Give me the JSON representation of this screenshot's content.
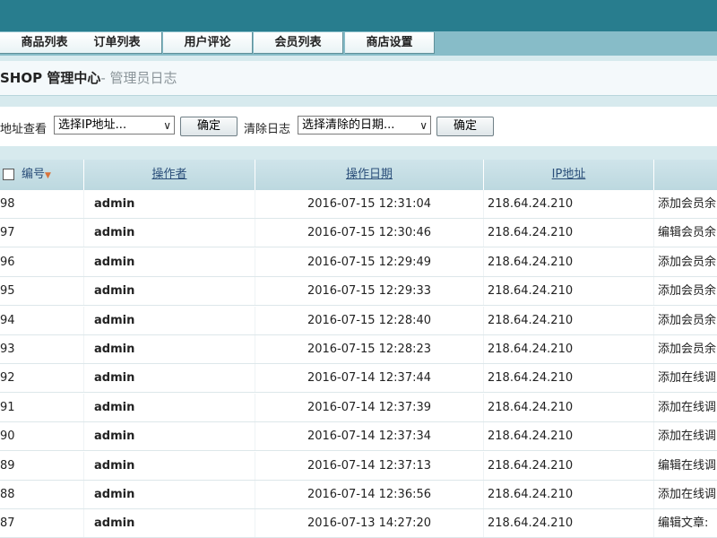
{
  "nav": {
    "tabs": [
      {
        "label": "商品列表"
      },
      {
        "label": "订单列表"
      },
      {
        "label": "用户评论"
      },
      {
        "label": "会员列表"
      },
      {
        "label": "商店设置"
      }
    ]
  },
  "title": {
    "main": "SHOP 管理中心",
    "sub": "- 管理员日志"
  },
  "filters": {
    "ip_label": "地址查看",
    "ip_select_value": "选择IP地址...",
    "confirm_label": "确定",
    "clear_label": "清除日志",
    "clear_select_value": "选择清除的日期...",
    "confirm2_label": "确定"
  },
  "table": {
    "headers": {
      "id": "编号",
      "sort_indicator": "▼",
      "user": "操作者",
      "date": "操作日期",
      "ip": "IP地址"
    },
    "rows": [
      {
        "id": "98",
        "user": "admin",
        "date": "2016-07-15 12:31:04",
        "ip": "218.64.24.210",
        "action": "添加会员余"
      },
      {
        "id": "97",
        "user": "admin",
        "date": "2016-07-15 12:30:46",
        "ip": "218.64.24.210",
        "action": "编辑会员余"
      },
      {
        "id": "96",
        "user": "admin",
        "date": "2016-07-15 12:29:49",
        "ip": "218.64.24.210",
        "action": "添加会员余"
      },
      {
        "id": "95",
        "user": "admin",
        "date": "2016-07-15 12:29:33",
        "ip": "218.64.24.210",
        "action": "添加会员余"
      },
      {
        "id": "94",
        "user": "admin",
        "date": "2016-07-15 12:28:40",
        "ip": "218.64.24.210",
        "action": "添加会员余"
      },
      {
        "id": "93",
        "user": "admin",
        "date": "2016-07-15 12:28:23",
        "ip": "218.64.24.210",
        "action": "添加会员余"
      },
      {
        "id": "92",
        "user": "admin",
        "date": "2016-07-14 12:37:44",
        "ip": "218.64.24.210",
        "action": "添加在线调"
      },
      {
        "id": "91",
        "user": "admin",
        "date": "2016-07-14 12:37:39",
        "ip": "218.64.24.210",
        "action": "添加在线调"
      },
      {
        "id": "90",
        "user": "admin",
        "date": "2016-07-14 12:37:34",
        "ip": "218.64.24.210",
        "action": "添加在线调"
      },
      {
        "id": "89",
        "user": "admin",
        "date": "2016-07-14 12:37:13",
        "ip": "218.64.24.210",
        "action": "编辑在线调"
      },
      {
        "id": "88",
        "user": "admin",
        "date": "2016-07-14 12:36:56",
        "ip": "218.64.24.210",
        "action": "添加在线调"
      },
      {
        "id": "87",
        "user": "admin",
        "date": "2016-07-13 14:27:20",
        "ip": "218.64.24.210",
        "action": "编辑文章:"
      }
    ]
  },
  "colors": {
    "top_bar": "#287d8e",
    "nav_bar": "#87bcc8",
    "header_link": "#2b4f7a"
  }
}
